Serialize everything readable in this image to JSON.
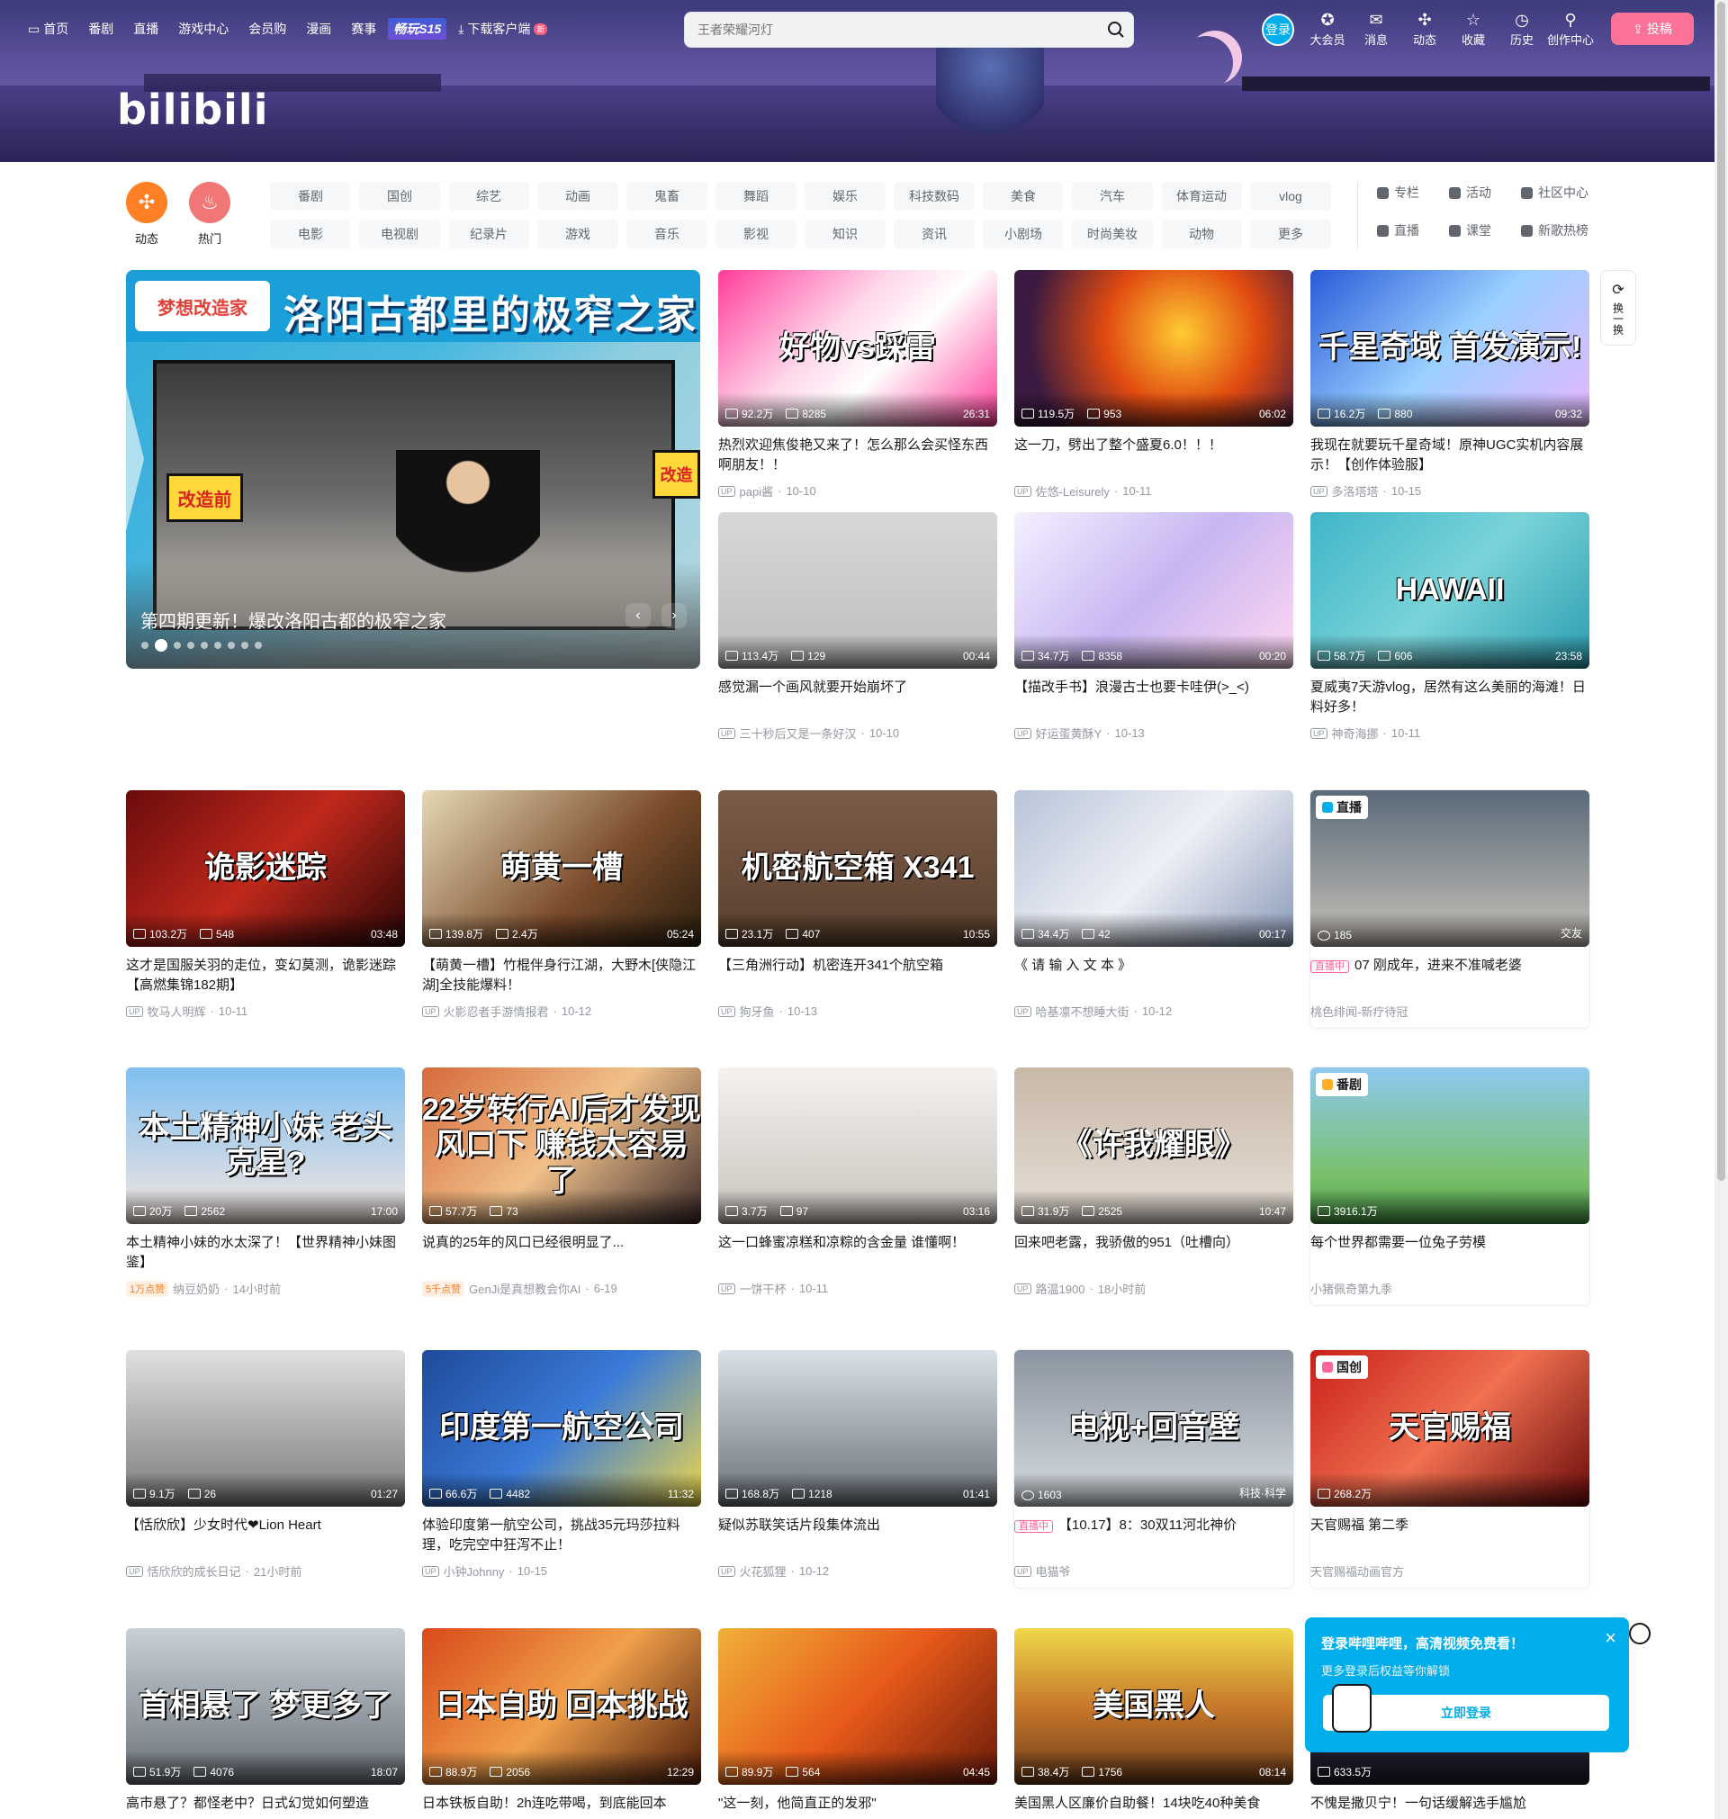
{
  "nav": {
    "left": [
      {
        "label": "首页",
        "icon": "tv-icon"
      },
      {
        "label": "番剧"
      },
      {
        "label": "直播"
      },
      {
        "label": "游戏中心"
      },
      {
        "label": "会员购"
      },
      {
        "label": "漫画"
      },
      {
        "label": "赛事"
      },
      {
        "label": "畅玩S15"
      },
      {
        "label": "下载客户端",
        "icon": "download-icon",
        "badge": "新"
      }
    ],
    "search_placeholder": "王者荣耀河灯",
    "login": "登录",
    "right": [
      {
        "label": "大会员",
        "icon": "vip-icon"
      },
      {
        "label": "消息",
        "icon": "message-icon"
      },
      {
        "label": "动态",
        "icon": "dynamic-icon"
      },
      {
        "label": "收藏",
        "icon": "star-icon"
      },
      {
        "label": "历史",
        "icon": "clock-icon"
      },
      {
        "label": "创作中心",
        "icon": "bulb-icon"
      }
    ],
    "upload": "投稿"
  },
  "logo": "bilibili",
  "channels": {
    "round": [
      {
        "label": "动态",
        "color": "#ff7f24",
        "icon": "pinwheel-icon"
      },
      {
        "label": "热门",
        "color": "#f07775",
        "icon": "fire-icon"
      }
    ],
    "tags": [
      "番剧",
      "国创",
      "综艺",
      "动画",
      "鬼畜",
      "舞蹈",
      "娱乐",
      "科技数码",
      "美食",
      "汽车",
      "体育运动",
      "vlog",
      "电影",
      "电视剧",
      "纪录片",
      "游戏",
      "音乐",
      "影视",
      "知识",
      "资讯",
      "小剧场",
      "时尚美妆",
      "动物",
      "更多"
    ],
    "extra": [
      {
        "label": "专栏",
        "icon": "column-icon"
      },
      {
        "label": "活动",
        "icon": "activity-icon"
      },
      {
        "label": "社区中心",
        "icon": "community-icon"
      },
      {
        "label": "直播",
        "icon": "live-icon"
      },
      {
        "label": "课堂",
        "icon": "class-icon"
      },
      {
        "label": "新歌热榜",
        "icon": "music-icon"
      }
    ]
  },
  "carousel": {
    "banner_title": "洛阳古都里的极窄之家",
    "banner_highlight": "极窄之家",
    "stamp": "梦想改造家",
    "before": "改造前",
    "after": "改造",
    "caption": "第四期更新！爆改洛阳古都的极窄之家",
    "dots": 9,
    "active_dot": 1
  },
  "refresh": {
    "label": "换一换"
  },
  "videos": [
    {
      "title": "热烈欢迎焦俊艳又来了！怎么那么会买怪东西啊朋友！！",
      "views": "92.2万",
      "danmaku": "8285",
      "duration": "26:31",
      "author": "papi酱",
      "date": "10-10",
      "overlay": "好物vs踩雷",
      "bg": "linear-gradient(135deg,#ff3d9a,#ffd6ea 40%,#fff 60%,#ff3d9a)"
    },
    {
      "title": "这一刀，劈出了整个盛夏6.0！！！",
      "views": "119.5万",
      "danmaku": "953",
      "duration": "06:02",
      "author": "佐悠-Leisurely",
      "date": "10-11",
      "overlay": "",
      "bg": "radial-gradient(circle at 60% 40%,#ffcc33,#e04a10 40%,#3a1a40 80%)"
    },
    {
      "title": "我现在就要玩千星奇域！原神UGC实机内容展示！【创作体验服】",
      "views": "16.2万",
      "danmaku": "880",
      "duration": "09:32",
      "author": "多洛塔塔",
      "date": "10-15",
      "overlay": "千星奇域 首发演示!",
      "bg": "linear-gradient(135deg,#2a5ad8,#9ad0ff 50%,#e7b7ff)"
    },
    {
      "title": "感觉漏一个画风就要开始崩坏了",
      "views": "113.4万",
      "danmaku": "129",
      "duration": "00:44",
      "author": "三十秒后又是一条好汉",
      "date": "10-10",
      "overlay": "",
      "bg": "linear-gradient(180deg,#d8d8d8,#bdbdbd)"
    },
    {
      "title": "【描改手书】浪漫古士也要卡哇伊(>_<)",
      "views": "34.7万",
      "danmaku": "8358",
      "duration": "00:20",
      "author": "好运蛋黄酥Y",
      "date": "10-13",
      "overlay": "",
      "bg": "linear-gradient(135deg,#f5f0ff,#c8b6f2 50%,#ffd8f0)"
    },
    {
      "title": "夏威夷7天游vlog，居然有这么美丽的海滩！日料好多！",
      "views": "58.7万",
      "danmaku": "606",
      "duration": "23:58",
      "author": "神奇海挪",
      "date": "10-11",
      "overlay": "HAWAII",
      "bg": "linear-gradient(135deg,#3fb6c8,#7ad3d9 50%,#2a9db0)"
    },
    {
      "title": "这才是国服关羽的走位，变幻莫测，诡影迷踪【高燃集锦182期】",
      "views": "103.2万",
      "danmaku": "548",
      "duration": "03:48",
      "author": "牧马人明辉",
      "date": "10-11",
      "overlay": "诡影迷踪",
      "bg": "linear-gradient(135deg,#6a0c0c,#c0281c 50%,#2a0606)"
    },
    {
      "title": "【萌黄一槽】竹棍伴身行江湖，大野木[侠隐江湖]全技能爆料！",
      "views": "139.8万",
      "danmaku": "2.4万",
      "duration": "05:24",
      "author": "火影忍者手游情报君",
      "date": "10-12",
      "overlay": "萌黄一槽",
      "bg": "linear-gradient(135deg,#e5d9b5,#7a4a2a 60%,#2a2010)"
    },
    {
      "title": "【三角洲行动】机密连开341个航空箱",
      "views": "23.1万",
      "danmaku": "407",
      "duration": "10:55",
      "author": "狗牙鱼",
      "date": "10-13",
      "overlay": "机密航空箱 X341",
      "bg": "linear-gradient(180deg,#7a5b46,#5a3f2f)"
    },
    {
      "title": "《 请 输 入 文 本 》",
      "views": "34.4万",
      "danmaku": "42",
      "duration": "00:17",
      "author": "哈基凛不想睡大街",
      "date": "10-12",
      "overlay": "",
      "bg": "linear-gradient(135deg,#b8c4d8,#eef0f6 50%,#8a9ab8)"
    },
    {
      "title": "07 刚成年，进来不准喊老婆",
      "views": "185",
      "danmaku": "",
      "duration": "交友",
      "author": "桃色绯闻-新疗待冠",
      "date": "",
      "overlay": "",
      "bg": "linear-gradient(180deg,#5a6a7a,#c8c2b8)",
      "live": true,
      "tag": "直播"
    },
    {
      "title": "本土精神小妹的水太深了！【世界精神小妹图鉴】",
      "views": "20万",
      "danmaku": "2562",
      "duration": "17:00",
      "author": "纳豆奶奶",
      "date": "14小时前",
      "overlay": "本土精神小妹 老头克星?",
      "bg": "linear-gradient(180deg,#7fbff0,#f5e6e0)",
      "hot": "1万点赞"
    },
    {
      "title": "说真的25年的风口已经很明显了...",
      "views": "57.7万",
      "danmaku": "73",
      "duration": "",
      "author": "GenJi是真想教会你AI",
      "date": "6-19",
      "overlay": "22岁转行AI后才发现 风口下 赚钱太容易了",
      "bg": "linear-gradient(135deg,#d66a3a,#f0c08a 50%,#3a2a2a)",
      "hot": "5千点赞"
    },
    {
      "title": "这一口蜂蜜凉糕和凉粽的含金量 谁懂啊！",
      "views": "3.7万",
      "danmaku": "97",
      "duration": "03:16",
      "author": "一饼干杯",
      "date": "10-11",
      "overlay": "",
      "bg": "linear-gradient(180deg,#f5f2ee,#c8c2bc)"
    },
    {
      "title": "回来吧老露，我骄傲的951（吐槽向）",
      "views": "31.9万",
      "danmaku": "2525",
      "duration": "10:47",
      "author": "路温1900",
      "date": "18小时前",
      "overlay": "《许我耀眼》",
      "bg": "linear-gradient(180deg,#c8b8a8,#e8e0d8)"
    },
    {
      "title": "每个世界都需要一位兔子劳模",
      "views": "3916.1万",
      "danmaku": "",
      "duration": "",
      "author": "小猪佩奇第九季",
      "date": "",
      "overlay": "",
      "bg": "linear-gradient(180deg,#8ec8f0,#7ac06a 70%,#4a9a4a)",
      "tag": "番剧"
    },
    {
      "title": "【恬欣欣】少女时代❤Lion Heart",
      "views": "9.1万",
      "danmaku": "26",
      "duration": "01:27",
      "author": "恬欣欣的成长日记",
      "date": "21小时前",
      "overlay": "",
      "bg": "linear-gradient(180deg,#e0e0e0,#7a7a7a)"
    },
    {
      "title": "体验印度第一航空公司，挑战35元玛莎拉料理，吃完空中狂泻不止！",
      "views": "66.6万",
      "danmaku": "4482",
      "duration": "11:32",
      "author": "小钟Johnny",
      "date": "10-15",
      "overlay": "印度第一航空公司",
      "bg": "linear-gradient(135deg,#1f4a9a,#3a7ad8 50%,#f0d84a)"
    },
    {
      "title": "疑似苏联笑话片段集体流出",
      "views": "168.8万",
      "danmaku": "1218",
      "duration": "01:41",
      "author": "火花狐狸",
      "date": "10-12",
      "overlay": "",
      "bg": "linear-gradient(180deg,#d8e0e8,#6a7078)"
    },
    {
      "title": "【10.17】8：30双11河北神价",
      "views": "1603",
      "danmaku": "",
      "duration": "科技·科学",
      "author": "电猫爷",
      "date": "",
      "overlay": "电视+回音壁",
      "bg": "linear-gradient(180deg,#8a94a0,#d8dde2)",
      "live": true
    },
    {
      "title": "天官赐福 第二季",
      "views": "268.2万",
      "danmaku": "",
      "duration": "",
      "author": "天官赐福动画官方",
      "date": "",
      "overlay": "天官赐福",
      "bg": "linear-gradient(135deg,#c8201a,#f07050 50%,#6a0a0a)",
      "tag": "国创"
    },
    {
      "title": "高市悬了？都怪老中？日式幻觉如何塑造",
      "views": "51.9万",
      "danmaku": "4076",
      "duration": "18:07",
      "author": "",
      "date": "",
      "overlay": "首相悬了 梦更多了",
      "bg": "linear-gradient(180deg,#c8d0d8,#6a7078)"
    },
    {
      "title": "日本铁板自助！2h连吃带喝，到底能回本",
      "views": "88.9万",
      "danmaku": "2056",
      "duration": "12:29",
      "author": "",
      "date": "",
      "overlay": "日本自助 回本挑战",
      "bg": "linear-gradient(135deg,#d84a1a,#f0a04a 50%,#4a1a0a)"
    },
    {
      "title": "\"这一刻，他简直正的发邪\"",
      "views": "89.9万",
      "danmaku": "564",
      "duration": "04:45",
      "author": "",
      "date": "",
      "overlay": "",
      "bg": "linear-gradient(135deg,#f0b03a,#e85a1a 50%,#6a1a0a)"
    },
    {
      "title": "美国黑人区廉价自助餐！14块吃40种美食",
      "views": "38.4万",
      "danmaku": "1756",
      "duration": "08:14",
      "author": "",
      "date": "",
      "overlay": "美国黑人",
      "bg": "linear-gradient(180deg,#f0d84a,#c8782a 50%,#6a3a1a)"
    },
    {
      "title": "不愧是撒贝宁！一句话缓解选手尴尬",
      "views": "633.5万",
      "danmaku": "",
      "duration": "",
      "author": "",
      "date": "",
      "overlay": "",
      "bg": "linear-gradient(180deg,#2a2a3a,#1a1a2a)"
    }
  ],
  "popup": {
    "title": "登录哔哩哔哩，高清视频免费看！",
    "subtitle": "更多登录后权益等你解锁",
    "button": "立即登录",
    "close": "×"
  }
}
